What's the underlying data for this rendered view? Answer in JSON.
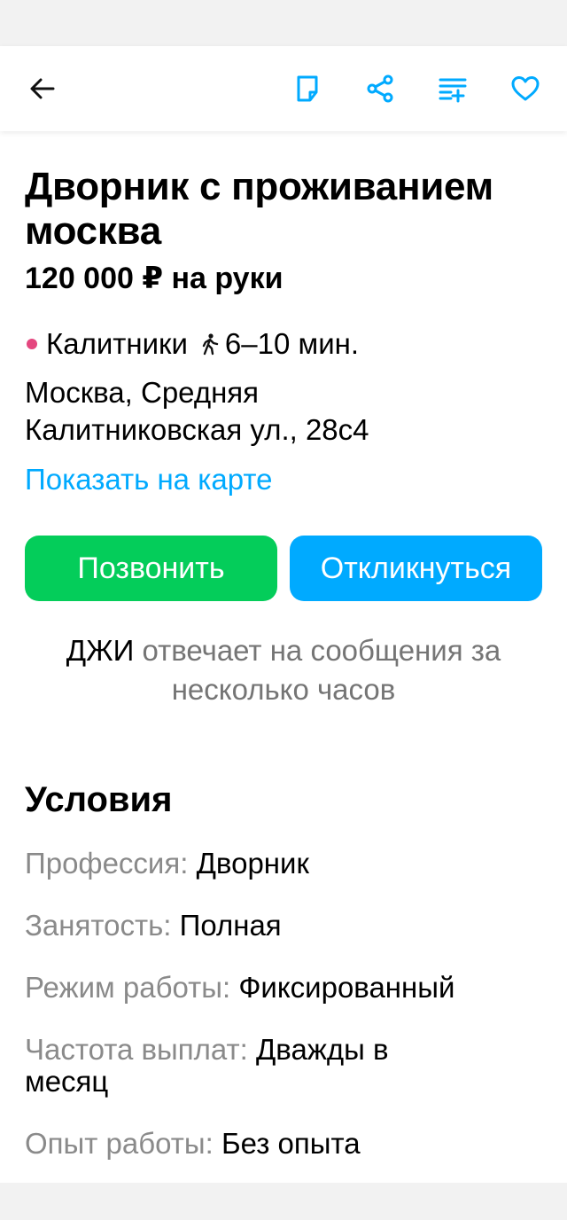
{
  "colors": {
    "accent": "#00aaff",
    "green": "#04cd5a",
    "metro_dot": "#e4477f",
    "muted": "#8a8a8a"
  },
  "header": {
    "back_icon": "arrow-left-icon",
    "actions": [
      "note-icon",
      "share-icon",
      "compare-list-icon",
      "heart-icon"
    ]
  },
  "vacancy": {
    "title": "Дворник с проживанием москва",
    "salary": "120 000 ₽ на руки",
    "metro_station": "Калитники",
    "metro_time": "6–10 мин.",
    "address": "Москва, Средняя Калитниковская ул., 28с4",
    "map_link": "Показать на карте"
  },
  "actions": {
    "call_label": "Позвонить",
    "respond_label": "Откликнуться"
  },
  "employer_note": {
    "company": "ДЖИ",
    "text": " отвечает на сообщения за несколько часов"
  },
  "conditions": {
    "title": "Условия",
    "items": [
      {
        "label": "Профессия:",
        "value": "Дворник"
      },
      {
        "label": "Занятость:",
        "value": "Полная"
      },
      {
        "label": "Режим работы:",
        "value": "Фиксированный"
      },
      {
        "label": "Частота выплат:",
        "value": "Дважды в месяц"
      },
      {
        "label": "Опыт работы:",
        "value": "Без опыта"
      }
    ]
  }
}
